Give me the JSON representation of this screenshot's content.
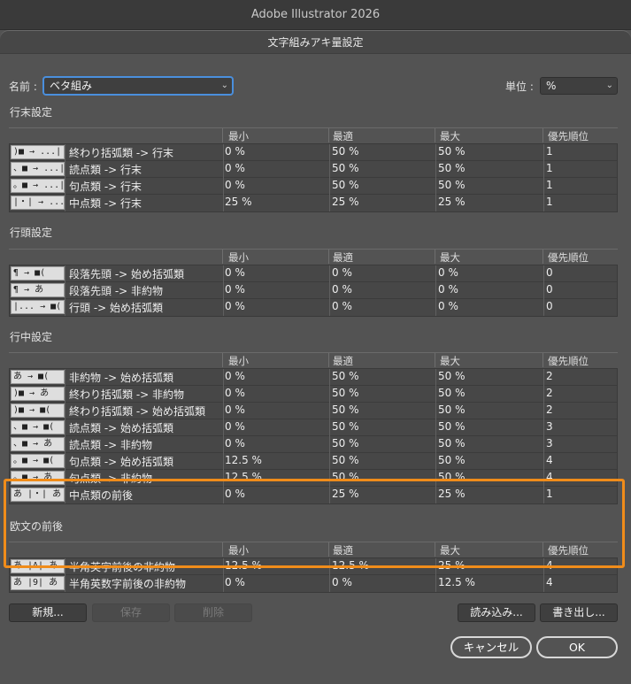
{
  "app_title": "Adobe Illustrator 2026",
  "dialog_title": "文字組みアキ量設定",
  "name_label": "名前 :",
  "name_value": "ベタ組み",
  "unit_label": "単位 :",
  "unit_value": "%",
  "columns": {
    "min": "最小",
    "optimal": "最適",
    "max": "最大",
    "priority": "優先順位"
  },
  "sections": [
    {
      "title": "行末設定",
      "rows": [
        {
          "icon": ")■ → ...|",
          "name": "終わり括弧類 -> 行末",
          "min": "0 %",
          "opt": "50 %",
          "max": "50 %",
          "pri": "1"
        },
        {
          "icon": "、■ → ...|",
          "name": "読点類 -> 行末",
          "min": "0 %",
          "opt": "50 %",
          "max": "50 %",
          "pri": "1"
        },
        {
          "icon": "。■ → ...|",
          "name": "句点類 -> 行末",
          "min": "0 %",
          "opt": "50 %",
          "max": "50 %",
          "pri": "1"
        },
        {
          "icon": "|・| → ...|",
          "name": "中点類 -> 行末",
          "min": "25 %",
          "opt": "25 %",
          "max": "25 %",
          "pri": "1"
        }
      ]
    },
    {
      "title": "行頭設定",
      "rows": [
        {
          "icon": "¶ → ■(",
          "name": "段落先頭 -> 始め括弧類",
          "min": "0 %",
          "opt": "0 %",
          "max": "0 %",
          "pri": "0"
        },
        {
          "icon": "¶ → あ",
          "name": "段落先頭 -> 非約物",
          "min": "0 %",
          "opt": "0 %",
          "max": "0 %",
          "pri": "0"
        },
        {
          "icon": "|... → ■(",
          "name": "行頭 -> 始め括弧類",
          "min": "0 %",
          "opt": "0 %",
          "max": "0 %",
          "pri": "0"
        }
      ]
    },
    {
      "title": "行中設定",
      "rows": [
        {
          "icon": "あ → ■(",
          "name": "非約物 -> 始め括弧類",
          "min": "0 %",
          "opt": "50 %",
          "max": "50 %",
          "pri": "2"
        },
        {
          "icon": ")■ → あ",
          "name": "終わり括弧類 -> 非約物",
          "min": "0 %",
          "opt": "50 %",
          "max": "50 %",
          "pri": "2"
        },
        {
          "icon": ")■ → ■(",
          "name": "終わり括弧類 -> 始め括弧類",
          "min": "0 %",
          "opt": "50 %",
          "max": "50 %",
          "pri": "2"
        },
        {
          "icon": "、■ → ■(",
          "name": "読点類 -> 始め括弧類",
          "min": "0 %",
          "opt": "50 %",
          "max": "50 %",
          "pri": "3"
        },
        {
          "icon": "、■ → あ",
          "name": "読点類 -> 非約物",
          "min": "0 %",
          "opt": "50 %",
          "max": "50 %",
          "pri": "3"
        },
        {
          "icon": "。■ → ■(",
          "name": "句点類 -> 始め括弧類",
          "min": "12.5 %",
          "opt": "50 %",
          "max": "50 %",
          "pri": "4"
        },
        {
          "icon": "。■ → あ",
          "name": "句点類 -> 非約物",
          "min": "12.5 %",
          "opt": "50 %",
          "max": "50 %",
          "pri": "4"
        },
        {
          "icon": "あ |・| あ",
          "name": "中点類の前後",
          "min": "0 %",
          "opt": "25 %",
          "max": "25 %",
          "pri": "1"
        }
      ]
    },
    {
      "title": "欧文の前後",
      "rows": [
        {
          "icon": "あ |A| あ",
          "name": "半角英字前後の非約物",
          "min": "12.5 %",
          "opt": "12.5 %",
          "max": "25 %",
          "pri": "4"
        },
        {
          "icon": "あ |9| あ",
          "name": "半角英数字前後の非約物",
          "min": "0 %",
          "opt": "0 %",
          "max": "12.5 %",
          "pri": "4"
        }
      ]
    }
  ],
  "buttons": {
    "new": "新規...",
    "save": "保存",
    "delete": "削除",
    "import": "読み込み...",
    "export": "書き出し...",
    "cancel": "キャンセル",
    "ok": "OK"
  },
  "colors": {
    "highlight": "#f08c1a",
    "focus": "#4a8fdd"
  }
}
